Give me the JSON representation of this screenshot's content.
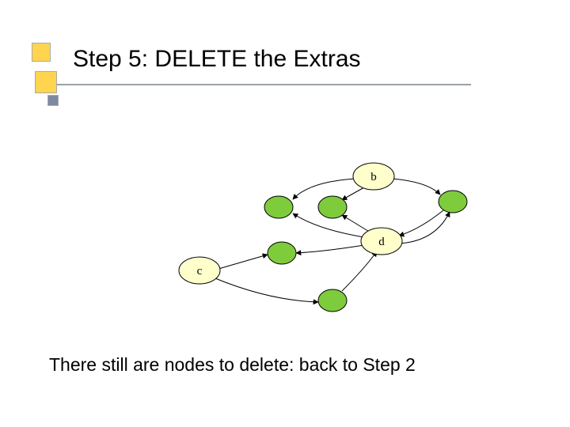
{
  "slide": {
    "title": "Step 5: DELETE the Extras",
    "caption": "There still are nodes to delete: back to Step 2"
  },
  "graph": {
    "nodes": {
      "b": "b",
      "c": "c",
      "d": "d"
    }
  }
}
